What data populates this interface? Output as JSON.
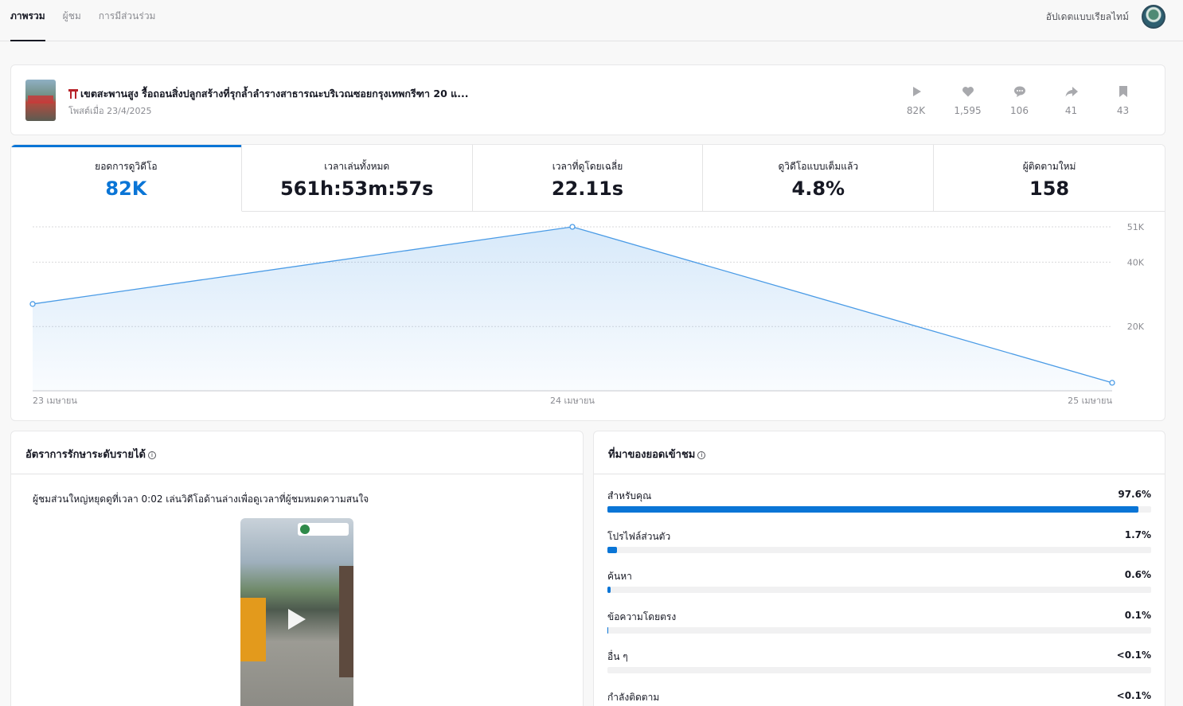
{
  "nav": {
    "tabs": [
      {
        "label": "ภาพรวม",
        "active": true
      },
      {
        "label": "ผู้ชม",
        "active": false
      },
      {
        "label": "การมีส่วนร่วม",
        "active": false
      }
    ],
    "realtime_label": "อัปเดตแบบเรียลไทม์"
  },
  "video": {
    "title": "เขตสะพานสูง รื้อถอนสิ่งปลูกสร้างที่รุกล้ำลำรางสาธารณะบริเวณซอยกรุงเทพกรีฑา 20 แ...",
    "posted": "โพสต์เมื่อ 23/4/2025",
    "stats": [
      {
        "icon": "play-icon",
        "value": "82K"
      },
      {
        "icon": "heart-icon",
        "value": "1,595"
      },
      {
        "icon": "comment-icon",
        "value": "106"
      },
      {
        "icon": "share-icon",
        "value": "41"
      },
      {
        "icon": "bookmark-icon",
        "value": "43"
      }
    ]
  },
  "metrics": [
    {
      "label": "ยอดการดูวิดีโอ",
      "value": "82K",
      "active": true
    },
    {
      "label": "เวลาเล่นทั้งหมด",
      "value": "561h:53m:57s",
      "active": false
    },
    {
      "label": "เวลาที่ดูโดยเฉลี่ย",
      "value": "22.11s",
      "active": false
    },
    {
      "label": "ดูวิดีโอแบบเต็มแล้ว",
      "value": "4.8%",
      "active": false
    },
    {
      "label": "ผู้ติดตามใหม่",
      "value": "158",
      "active": false
    }
  ],
  "chart_data": {
    "type": "area",
    "categories": [
      "23 เมษายน",
      "24 เมษายน",
      "25 เมษายน"
    ],
    "values": [
      27000,
      51000,
      2500
    ],
    "y_ticks": [
      {
        "value": 51000,
        "label": "51K"
      },
      {
        "value": 40000,
        "label": "40K"
      },
      {
        "value": 20000,
        "label": "20K"
      }
    ],
    "ylim": [
      0,
      51000
    ],
    "color": "#4a9be6",
    "grid": true
  },
  "retention": {
    "title": "อัตราการรักษาระดับรายได้",
    "description": "ผู้ชมส่วนใหญ่หยุดดูที่เวลา 0:02 เล่นวิดีโอด้านล่างเพื่อดูเวลาที่ผู้ชมหมดความสนใจ"
  },
  "sources": {
    "title": "ที่มาของยอดเข้าชม",
    "items": [
      {
        "name": "สำหรับคุณ",
        "percent": "97.6%",
        "fraction": 0.976
      },
      {
        "name": "โปรไฟล์ส่วนตัว",
        "percent": "1.7%",
        "fraction": 0.017
      },
      {
        "name": "ค้นหา",
        "percent": "0.6%",
        "fraction": 0.006
      },
      {
        "name": "ข้อความโดยตรง",
        "percent": "0.1%",
        "fraction": 0.001
      },
      {
        "name": "อื่น ๆ",
        "percent": "<0.1%",
        "fraction": 0.0
      },
      {
        "name": "กำลังติดตาม",
        "percent": "<0.1%",
        "fraction": 0.0
      }
    ]
  },
  "colors": {
    "accent": "#0a75d6"
  }
}
